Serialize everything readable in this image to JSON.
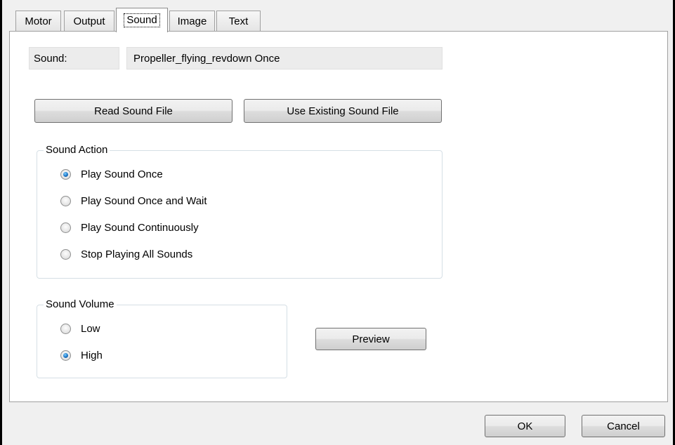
{
  "tabs": [
    {
      "label": "Motor"
    },
    {
      "label": "Output"
    },
    {
      "label": "Sound"
    },
    {
      "label": "Image"
    },
    {
      "label": "Text"
    }
  ],
  "active_tab": "Sound",
  "sound": {
    "label": "Sound:",
    "value": "Propeller_flying_revdown Once"
  },
  "buttons": {
    "read_sound_file": "Read Sound File",
    "use_existing_sound_file": "Use Existing Sound File",
    "preview": "Preview",
    "ok": "OK",
    "cancel": "Cancel"
  },
  "sound_action": {
    "title": "Sound Action",
    "options": [
      {
        "label": "Play Sound Once",
        "checked": true
      },
      {
        "label": "Play Sound Once and Wait",
        "checked": false
      },
      {
        "label": "Play Sound Continuously",
        "checked": false
      },
      {
        "label": "Stop Playing All Sounds",
        "checked": false
      }
    ]
  },
  "sound_volume": {
    "title": "Sound Volume",
    "options": [
      {
        "label": "Low",
        "checked": false
      },
      {
        "label": "High",
        "checked": true
      }
    ]
  },
  "colors": {
    "dialog_bg": "#f0f0f0",
    "page_bg": "#ffffff",
    "radio_selected": "#1b74c5"
  }
}
